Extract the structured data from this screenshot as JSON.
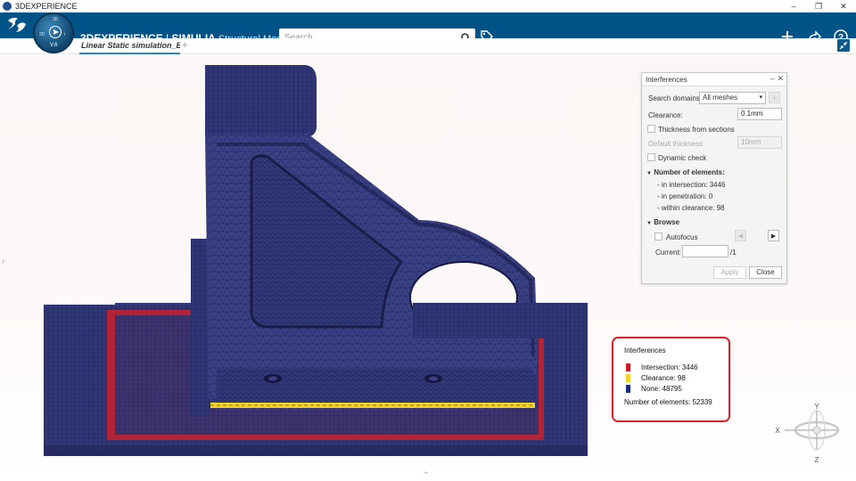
{
  "window": {
    "title": "3DEXPERIENCE"
  },
  "brand": {
    "part1": "3DEXPERIENCE",
    "sep": " | ",
    "part2": "SIMULIA",
    "app": " Structural Model Creation"
  },
  "compass": {
    "version": "V.6"
  },
  "search": {
    "placeholder": "Search"
  },
  "tabs": [
    {
      "label": "Linear Static simulation_Bo"
    }
  ],
  "icons": {
    "app": "3ds-logo-icon",
    "search": "search-icon",
    "tag": "tag-icon",
    "add": "plus-icon",
    "share": "share-icon",
    "help": "help-icon",
    "collapse": "collapse-icon"
  },
  "panel": {
    "title": "Interferences",
    "search_domains_label": "Search domains:",
    "search_domains_value": "All meshes",
    "clearance_label": "Clearance:",
    "clearance_value": "0.1mm",
    "thickness_from_sections": "Thickness from sections",
    "default_thickness_label": "Default thickness:",
    "default_thickness_value": "10mm",
    "dynamic_check": "Dynamic check",
    "number_of_elements_header": "Number of elements:",
    "stats": [
      "- in intersection: 3446",
      "- in penetration: 0",
      "- within clearance: 98"
    ],
    "browse_header": "Browse",
    "autofocus": "Autofocus",
    "current_label": "Current:",
    "current_total": "/1",
    "apply": "Apply",
    "close": "Close"
  },
  "legend": {
    "title": "Interferences",
    "items": [
      {
        "label": "Intersection: 3446",
        "color": "#c8202a"
      },
      {
        "label": "Clearance: 98",
        "color": "#f2d129"
      },
      {
        "label": "None: 48795",
        "color": "#1b2a7a"
      }
    ],
    "total": "Number of elements: 52339"
  },
  "triad": {
    "x": "X",
    "y": "Y",
    "z": "Z"
  },
  "colors": {
    "topbar": "#005386",
    "mesh": "#2f3575",
    "intersection": "#c8202a",
    "clearance": "#f2d129",
    "accent": "#2a86c6"
  }
}
